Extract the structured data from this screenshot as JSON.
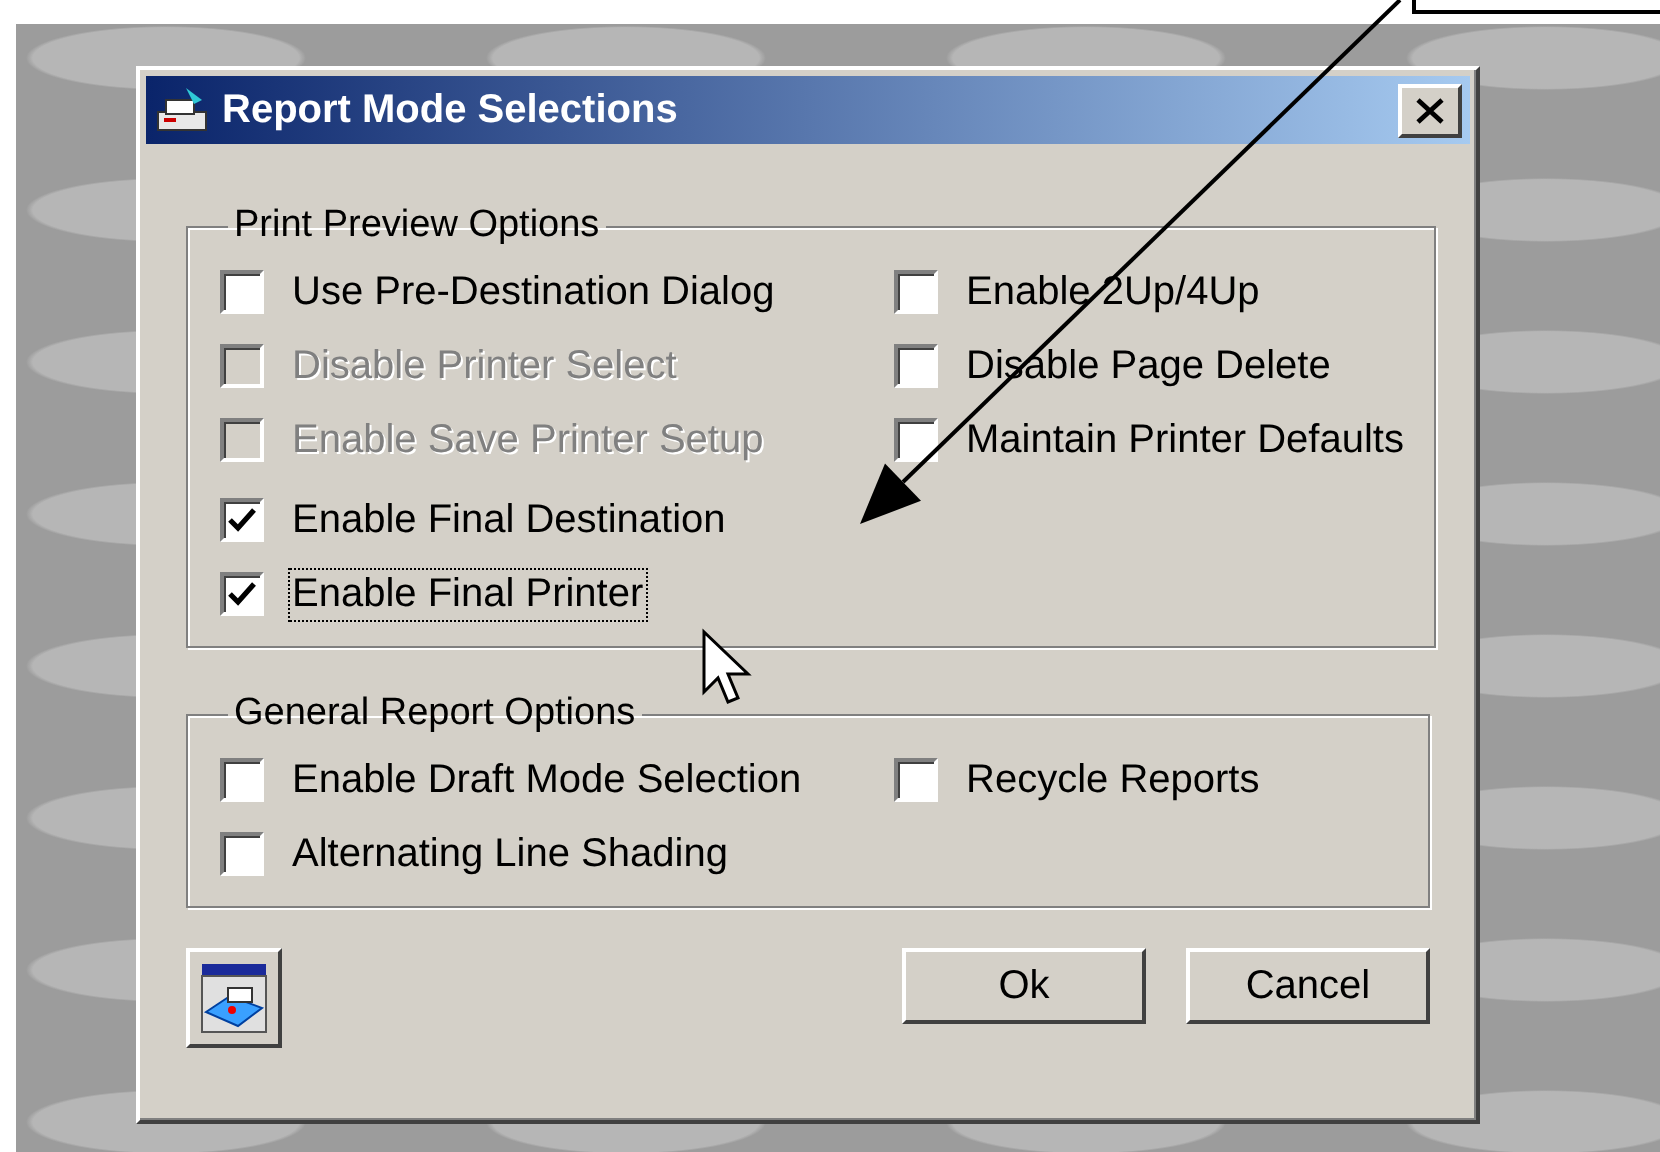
{
  "window": {
    "title": "Report Mode Selections"
  },
  "groups": [
    {
      "title": "Print Preview Options",
      "sections": [
        {
          "kind": "two_column",
          "items": [
            {
              "label": "Use Pre-Destination Dialog",
              "checked": false,
              "disabled": false,
              "focused": false
            },
            {
              "label": "Enable 2Up/4Up",
              "checked": false,
              "disabled": false,
              "focused": false
            },
            {
              "label": "Disable Printer Select",
              "checked": false,
              "disabled": true,
              "focused": false
            },
            {
              "label": "Disable Page Delete",
              "checked": false,
              "disabled": false,
              "focused": false
            },
            {
              "label": "Enable Save Printer Setup",
              "checked": false,
              "disabled": true,
              "focused": false
            },
            {
              "label": "Maintain Printer Defaults",
              "checked": false,
              "disabled": false,
              "focused": false
            }
          ]
        },
        {
          "kind": "one_column",
          "items": [
            {
              "label": "Enable Final Destination",
              "checked": true,
              "disabled": false,
              "focused": false
            },
            {
              "label": "Enable Final Printer",
              "checked": true,
              "disabled": false,
              "focused": true
            }
          ]
        }
      ]
    },
    {
      "title": "General Report Options",
      "sections": [
        {
          "kind": "two_column",
          "items": [
            {
              "label": "Enable Draft Mode Selection",
              "checked": false,
              "disabled": false,
              "focused": false
            },
            {
              "label": "Recycle Reports",
              "checked": false,
              "disabled": false,
              "focused": false
            },
            {
              "label": "Alternating Line Shading",
              "checked": false,
              "disabled": false,
              "focused": false
            }
          ]
        }
      ]
    }
  ],
  "buttons": [
    {
      "label": "Ok"
    },
    {
      "label": "Cancel"
    }
  ]
}
